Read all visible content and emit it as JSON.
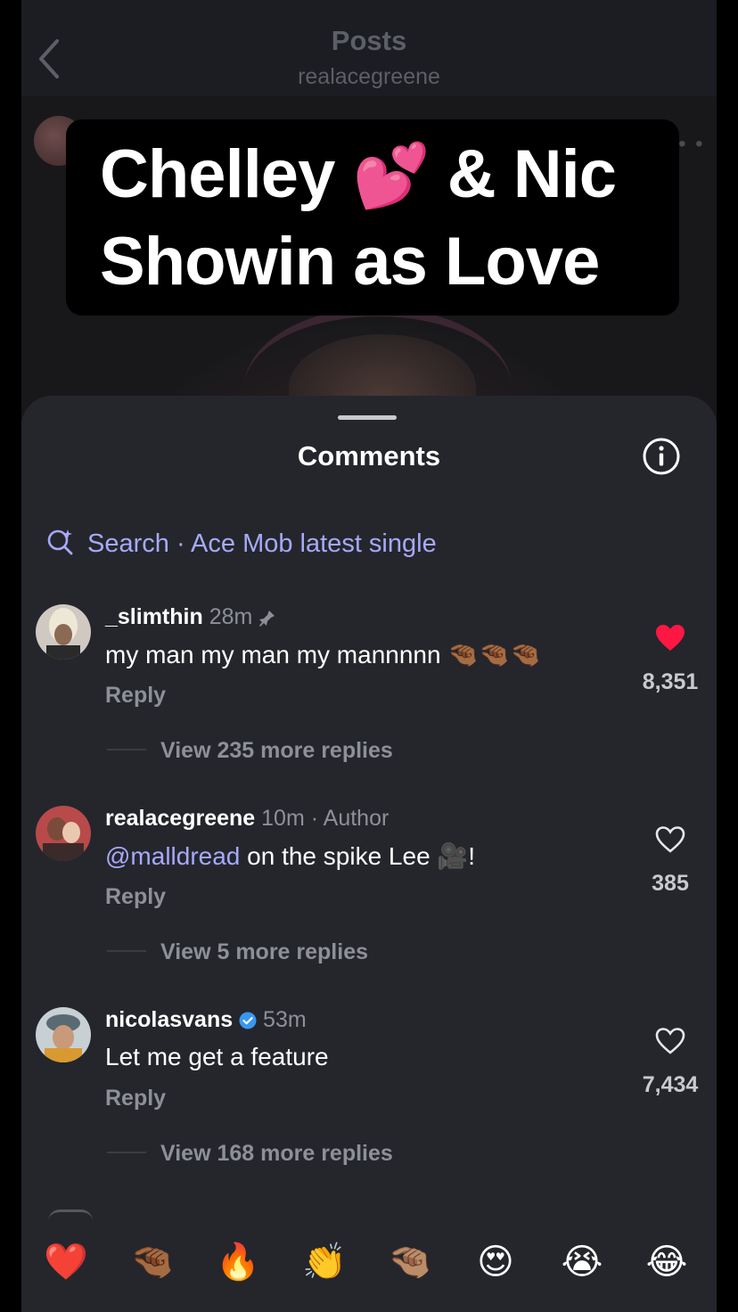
{
  "header": {
    "title": "Posts",
    "username": "realacegreene"
  },
  "overlay": {
    "line1_a": "Chelley",
    "line1_emoji": "💕",
    "line1_b": "& Nic",
    "line2": "Showin as Love"
  },
  "sheet": {
    "title": "Comments",
    "search_label": "Search · Ace Mob latest single"
  },
  "comments": [
    {
      "username": "_slimthin",
      "time": "28m",
      "pinned": true,
      "text": "my man my man my mannnnn 🤏🏾🤏🏾🤏🏾",
      "reply_label": "Reply",
      "view_replies": "View 235 more replies",
      "likes": "8,351",
      "liked": true
    },
    {
      "username": "realacegreene",
      "time": "10m",
      "author_tag": "Author",
      "mention": "@malldread",
      "text": " on the spike Lee 🎥!",
      "reply_label": "Reply",
      "view_replies": "View 5 more replies",
      "likes": "385",
      "liked": false
    },
    {
      "username": "nicolasvans",
      "verified": true,
      "time": "53m",
      "text": "Let me get a feature",
      "reply_label": "Reply",
      "view_replies": "View 168 more replies",
      "likes": "7,434",
      "liked": false
    }
  ],
  "emoji_bar": [
    "❤️",
    "🤏🏾",
    "🔥",
    "👏",
    "🤏🏽",
    "😍",
    "😭",
    "😂"
  ],
  "colors": {
    "accent_link": "#a7a9f9",
    "like_red": "#ff1744",
    "sheet_bg": "#24262c"
  }
}
